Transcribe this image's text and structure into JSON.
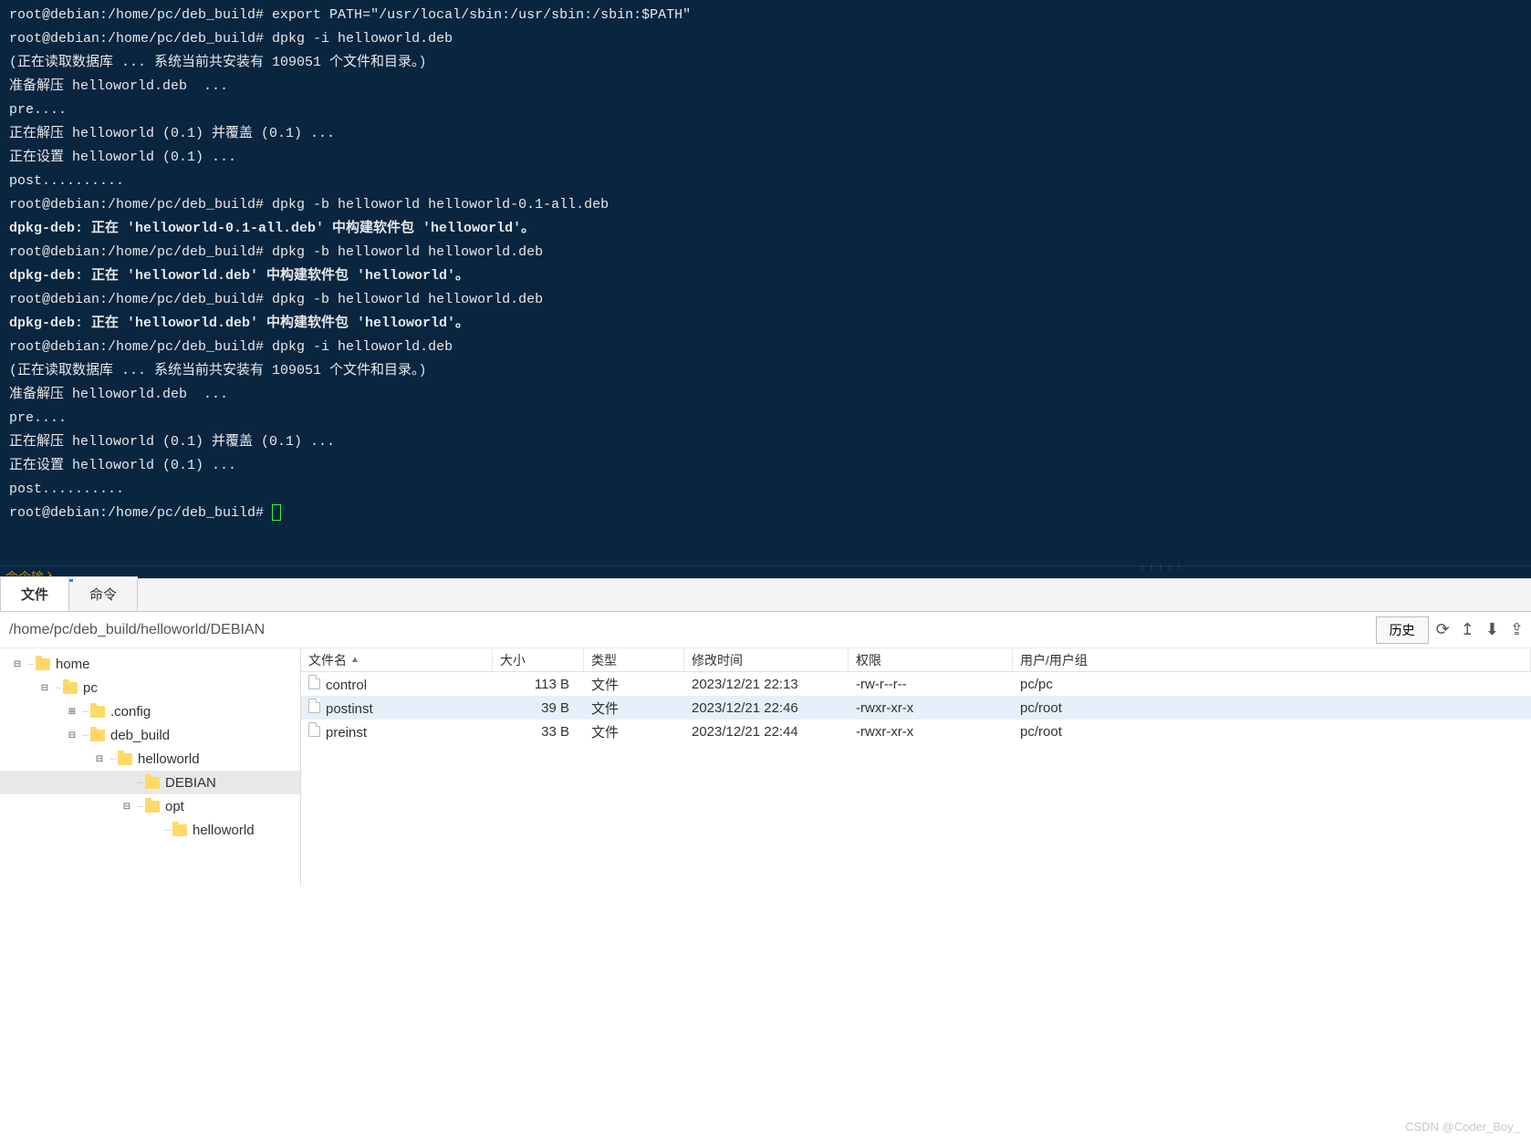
{
  "terminal": {
    "lines": [
      "root@debian:/home/pc/deb_build# export PATH=\"/usr/local/sbin:/usr/sbin:/sbin:$PATH\"",
      "root@debian:/home/pc/deb_build# dpkg -i helloworld.deb",
      "(正在读取数据库 ... 系统当前共安装有 109051 个文件和目录。)",
      "准备解压 helloworld.deb  ...",
      "pre....",
      "正在解压 helloworld (0.1) 并覆盖 (0.1) ...",
      "正在设置 helloworld (0.1) ...",
      "post..........",
      "root@debian:/home/pc/deb_build# dpkg -b helloworld helloworld-0.1-all.deb",
      "dpkg-deb: 正在 'helloworld-0.1-all.deb' 中构建软件包 'helloworld'。",
      "root@debian:/home/pc/deb_build# dpkg -b helloworld helloworld.deb",
      "dpkg-deb: 正在 'helloworld.deb' 中构建软件包 'helloworld'。",
      "root@debian:/home/pc/deb_build# dpkg -b helloworld helloworld.deb",
      "dpkg-deb: 正在 'helloworld.deb' 中构建软件包 'helloworld'。",
      "root@debian:/home/pc/deb_build# dpkg -i helloworld.deb",
      "(正在读取数据库 ... 系统当前共安装有 109051 个文件和目录。)",
      "准备解压 helloworld.deb  ...",
      "pre....",
      "正在解压 helloworld (0.1) 并覆盖 (0.1) ...",
      "正在设置 helloworld (0.1) ...",
      "post..........",
      "root@debian:/home/pc/deb_build# "
    ],
    "bold_lines": [
      9,
      11,
      13
    ],
    "input_label": "命令输入"
  },
  "tabs": {
    "file": "文件",
    "command": "命令"
  },
  "path_bar": {
    "path": "/home/pc/deb_build/helloworld/DEBIAN",
    "history": "历史"
  },
  "tree": [
    {
      "level": 0,
      "toggle": "⊟",
      "label": "home"
    },
    {
      "level": 1,
      "toggle": "⊟",
      "label": "pc"
    },
    {
      "level": 2,
      "toggle": "⊞",
      "label": ".config"
    },
    {
      "level": 2,
      "toggle": "⊟",
      "label": "deb_build"
    },
    {
      "level": 3,
      "toggle": "⊟",
      "label": "helloworld"
    },
    {
      "level": 4,
      "toggle": "",
      "label": "DEBIAN",
      "selected": true
    },
    {
      "level": 4,
      "toggle": "⊟",
      "label": "opt"
    },
    {
      "level": 5,
      "toggle": "",
      "label": "helloworld"
    }
  ],
  "list": {
    "headers": {
      "name": "文件名",
      "size": "大小",
      "type": "类型",
      "date": "修改时间",
      "perm": "权限",
      "owner": "用户/用户组"
    },
    "rows": [
      {
        "name": "control",
        "size": "113 B",
        "type": "文件",
        "date": "2023/12/21 22:13",
        "perm": "-rw-r--r--",
        "owner": "pc/pc"
      },
      {
        "name": "postinst",
        "size": "39 B",
        "type": "文件",
        "date": "2023/12/21 22:46",
        "perm": "-rwxr-xr-x",
        "owner": "pc/root",
        "selected": true
      },
      {
        "name": "preinst",
        "size": "33 B",
        "type": "文件",
        "date": "2023/12/21 22:44",
        "perm": "-rwxr-xr-x",
        "owner": "pc/root"
      }
    ]
  },
  "watermark": "CSDN @Coder_Boy_"
}
